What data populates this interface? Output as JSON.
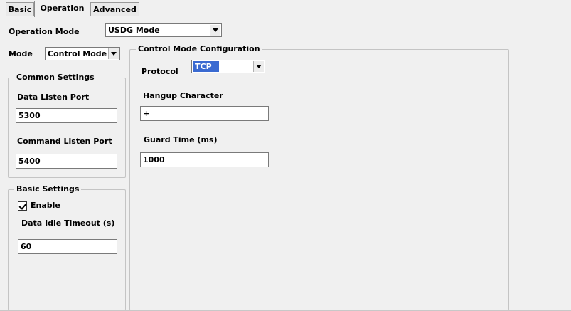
{
  "tabs": [
    {
      "label": "Basic"
    },
    {
      "label": "Operation"
    },
    {
      "label": "Advanced"
    }
  ],
  "operation_mode": {
    "label": "Operation Mode",
    "value": "USDG Mode"
  },
  "mode": {
    "label": "Mode",
    "value": "Control Mode"
  },
  "common_settings": {
    "title": "Common Settings",
    "data_listen_port": {
      "label": "Data Listen Port",
      "value": "5300"
    },
    "command_listen_port": {
      "label": "Command Listen Port",
      "value": "5400"
    }
  },
  "basic_settings": {
    "title": "Basic Settings",
    "enable": {
      "label": "Enable",
      "checked": true
    },
    "data_idle_timeout": {
      "label": "Data Idle Timeout (s)",
      "value": "60"
    }
  },
  "control_mode_config": {
    "title": "Control Mode Configuration",
    "protocol": {
      "label": "Protocol",
      "value": "TCP"
    },
    "hangup_character": {
      "label": "Hangup Character",
      "value": "+"
    },
    "guard_time": {
      "label": "Guard Time (ms)",
      "value": "1000"
    }
  }
}
